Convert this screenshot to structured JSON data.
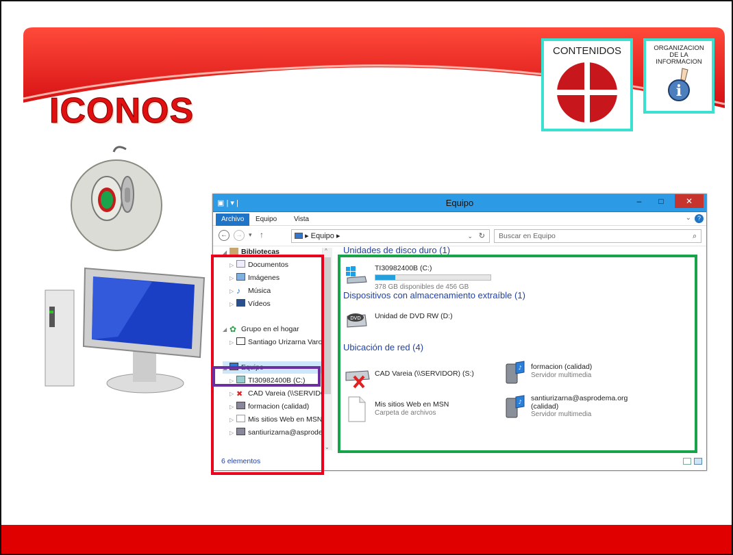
{
  "slide": {
    "title": "ICONOS",
    "nav": {
      "contenidos": "CONTENIDOS",
      "organizacion": "ORGANIZACION\nDE LA\nINFORMACION"
    }
  },
  "window": {
    "title": "Equipo",
    "ribbon_tabs": [
      "Archivo",
      "Equipo",
      "Vista"
    ],
    "address": "Equipo",
    "search_placeholder": "Buscar en Equipo",
    "tree": [
      {
        "label": "Bibliotecas",
        "level": 0
      },
      {
        "label": "Documentos",
        "level": 1
      },
      {
        "label": "Imágenes",
        "level": 1
      },
      {
        "label": "Música",
        "level": 1
      },
      {
        "label": "Vídeos",
        "level": 1
      },
      {
        "label": "Grupo en el hogar",
        "level": 0
      },
      {
        "label": "Santiago Urizarna Varo",
        "level": 1
      },
      {
        "label": "Equipo",
        "level": 0
      },
      {
        "label": "TI30982400B (C:)",
        "level": 1
      },
      {
        "label": "CAD Vareia (\\\\SERVIDOR",
        "level": 1
      },
      {
        "label": "formacion (calidad)",
        "level": 1
      },
      {
        "label": "Mis sitios Web en MSN",
        "level": 1
      },
      {
        "label": "santiurizarna@asprodema",
        "level": 1
      }
    ],
    "sections": {
      "hard_drives": "Unidades de disco duro (1)",
      "removable": "Dispositivos con almacenamiento extraíble (1)",
      "network": "Ubicación de red (4)"
    },
    "drive_c": {
      "name": "TI30982400B (C:)",
      "free": "378 GB disponibles de 456 GB",
      "used_fraction": 0.17
    },
    "dvd": {
      "name": "Unidad de DVD RW (D:)"
    },
    "network_items": [
      {
        "name": "CAD Vareia (\\\\SERVIDOR) (S:)",
        "sub": ""
      },
      {
        "name": "formacion (calidad)",
        "sub": "Servidor multimedia"
      },
      {
        "name": "Mis sitios Web en MSN",
        "sub": "Carpeta de archivos"
      },
      {
        "name": "santiurizarna@asprodema.org",
        "name2": "(calidad)",
        "sub": "Servidor multimedia"
      }
    ],
    "status": "6 elementos"
  },
  "colors": {
    "highlight_navigation": "#e8001c",
    "highlight_content": "#17a34a",
    "highlight_selected": "#6b2fa0",
    "accent": "#1e74c6"
  }
}
